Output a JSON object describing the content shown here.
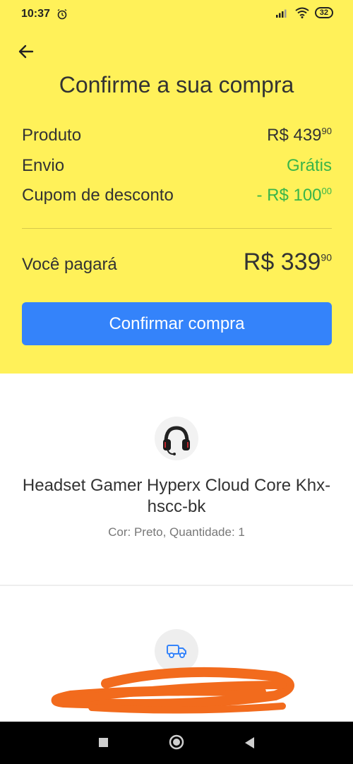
{
  "status_bar": {
    "time": "10:37",
    "battery": "32"
  },
  "header": {
    "title": "Confirme a sua compra",
    "rows": [
      {
        "label": "Produto",
        "value_main": "R$ 439",
        "value_cents": "90",
        "color": "#333333"
      },
      {
        "label": "Envio",
        "value_main": "Grátis",
        "value_cents": "",
        "color": "#39b54a"
      },
      {
        "label": "Cupom de desconto",
        "value_main": "- R$ 100",
        "value_cents": "00",
        "color": "#39b54a"
      }
    ],
    "total_label": "Você pagará",
    "total_main": "R$ 339",
    "total_cents": "90",
    "confirm_label": "Confirmar compra"
  },
  "product": {
    "name": "Headset Gamer Hyperx Cloud Core Khx-hscc-bk",
    "meta": "Cor: Preto, Quantidade: 1"
  },
  "colors": {
    "header_bg": "#fff159",
    "button_bg": "#3483fa",
    "green": "#39b54a",
    "redaction": "#f26b1d"
  },
  "icons": [
    "alarm-icon",
    "signal-icon",
    "wifi-icon",
    "back-arrow-icon",
    "headset-icon",
    "truck-icon",
    "nav-square-icon",
    "nav-home-icon",
    "nav-back-icon"
  ]
}
